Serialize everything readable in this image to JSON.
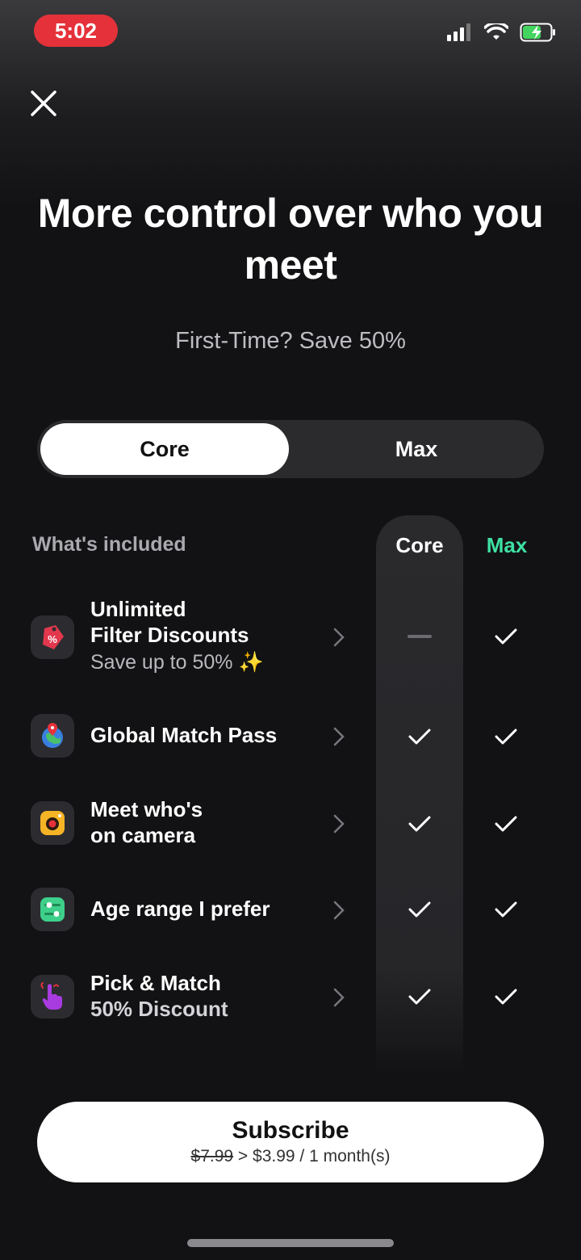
{
  "status_bar": {
    "time": "5:02"
  },
  "header": {
    "title": "More control over who you meet",
    "subtitle": "First-Time? Save 50%"
  },
  "plan_toggle": {
    "options": [
      "Core",
      "Max"
    ],
    "selected": "Core"
  },
  "table": {
    "label": "What's included",
    "col_core": "Core",
    "col_max": "Max",
    "max_color": "#3ee0a3",
    "features": [
      {
        "title_line1": "Unlimited",
        "title_line2": "Filter Discounts",
        "subtitle": "Save up to 50% ✨",
        "icon": "discount-tag-icon",
        "core": "not-included",
        "max": "included"
      },
      {
        "title_line1": "Global Match Pass",
        "title_line2": "",
        "subtitle": "",
        "icon": "globe-pin-icon",
        "core": "included",
        "max": "included"
      },
      {
        "title_line1": "Meet who's",
        "title_line2": "on camera",
        "subtitle": "",
        "icon": "camera-icon",
        "core": "included",
        "max": "included"
      },
      {
        "title_line1": "Age range I prefer",
        "title_line2": "",
        "subtitle": "",
        "icon": "sliders-icon",
        "core": "included",
        "max": "included"
      },
      {
        "title_line1": "Pick & Match",
        "title_line2": "50% Discount",
        "subtitle": "",
        "icon": "pointing-hand-icon",
        "core": "included",
        "max": "included"
      }
    ]
  },
  "subscribe": {
    "label": "Subscribe",
    "old_price": "$7.99",
    "price_text": " > $3.99 / 1 month(s)"
  }
}
